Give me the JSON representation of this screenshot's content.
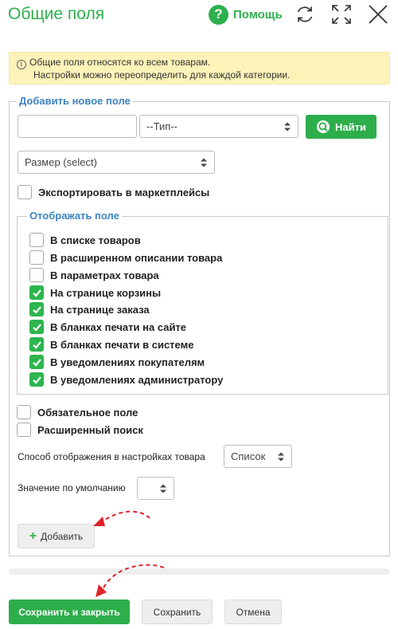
{
  "header": {
    "title": "Общие поля",
    "help_label": "Помощь",
    "help_glyph": "?"
  },
  "notice": {
    "line1": "Общие поля относятся ко всем товарам.",
    "line2": "Настройки можно переопределить для каждой категории.",
    "info_glyph": "i"
  },
  "add_field": {
    "legend": "Добавить новое поле",
    "name_value": "",
    "type_select": "--Тип--",
    "find_button": "Найти",
    "size_select": "Размер (select)",
    "export_label": "Экспортировать в маркетплейсы",
    "export_checked": false
  },
  "display": {
    "legend": "Отображать поле",
    "options": [
      {
        "label": "В списке товаров",
        "checked": false
      },
      {
        "label": "В расширенном описании товара",
        "checked": false
      },
      {
        "label": "В параметрах товара",
        "checked": false
      },
      {
        "label": "На странице корзины",
        "checked": true
      },
      {
        "label": "На странице заказа",
        "checked": true
      },
      {
        "label": "В бланках печати на сайте",
        "checked": true
      },
      {
        "label": "В бланках печати в системе",
        "checked": true
      },
      {
        "label": "В уведомлениях покупателям",
        "checked": true
      },
      {
        "label": "В уведомлениях администратору",
        "checked": true
      }
    ]
  },
  "extras": {
    "required_label": "Обязательное поле",
    "required_checked": false,
    "advanced_search_label": "Расширенный поиск",
    "advanced_search_checked": false,
    "display_mode_label": "Способ отображения в настройках товара",
    "display_mode_value": "Список",
    "default_value_label": "Значение по умолчанию",
    "default_value": ""
  },
  "actions": {
    "add_button": "Добавить",
    "add_glyph": "+",
    "save_close_button": "Сохранить и закрыть",
    "save_button": "Сохранить",
    "cancel_button": "Отмена"
  },
  "colors": {
    "accent_green": "#2eae4b",
    "legend_blue": "#3d84c3",
    "notice_bg": "#fdf3b9",
    "annotation_red": "#e0242a"
  },
  "icons": [
    "help-icon",
    "refresh-icon",
    "fullscreen-icon",
    "close-icon",
    "info-icon",
    "search-icon",
    "check-icon",
    "plus-icon",
    "select-arrows-icon",
    "annotation-arrow"
  ]
}
